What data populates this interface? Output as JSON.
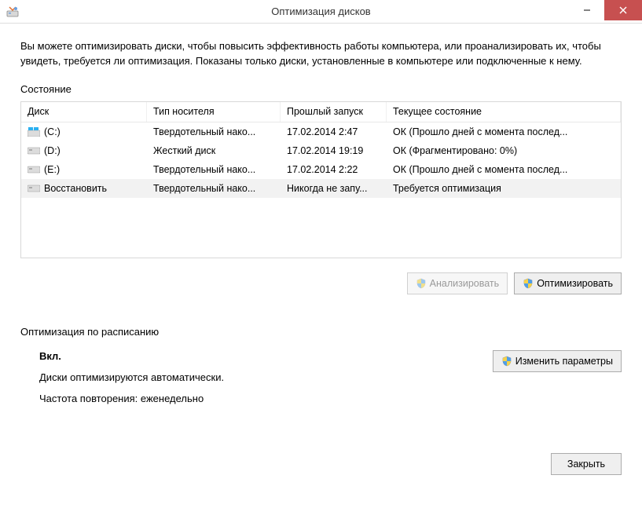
{
  "window": {
    "title": "Оптимизация дисков",
    "truncated_top": "—"
  },
  "description": "Вы можете оптимизировать диски, чтобы повысить эффективность работы  компьютера, или проанализировать их, чтобы увидеть, требуется ли оптимизация. Показаны только диски, установленные в компьютере или подключенные к нему.",
  "status_section_label": "Состояние",
  "columns": {
    "disk": "Диск",
    "type": "Тип носителя",
    "last": "Прошлый запуск",
    "status": "Текущее состояние"
  },
  "rows": [
    {
      "icon": "win",
      "name": "(C:)",
      "type": "Твердотельный нако...",
      "last": "17.02.2014 2:47",
      "status": "ОК (Прошло дней с момента послед..."
    },
    {
      "icon": "hdd",
      "name": "(D:)",
      "type": "Жесткий диск",
      "last": "17.02.2014 19:19",
      "status": "ОК (Фрагментировано: 0%)"
    },
    {
      "icon": "hdd",
      "name": "(E:)",
      "type": "Твердотельный нако...",
      "last": "17.02.2014 2:22",
      "status": "ОК (Прошло дней с момента послед..."
    },
    {
      "icon": "hdd",
      "name": "Восстановить",
      "type": "Твердотельный нако...",
      "last": "Никогда не запу...",
      "status": "Требуется оптимизация",
      "selected": true
    }
  ],
  "buttons": {
    "analyze": "Анализировать",
    "optimize": "Оптимизировать",
    "change_params": "Изменить параметры",
    "close": "Закрыть"
  },
  "schedule": {
    "section_label": "Оптимизация по расписанию",
    "on_label": "Вкл.",
    "auto_line": "Диски оптимизируются автоматически.",
    "freq_line": "Частота повторения: еженедельно"
  }
}
